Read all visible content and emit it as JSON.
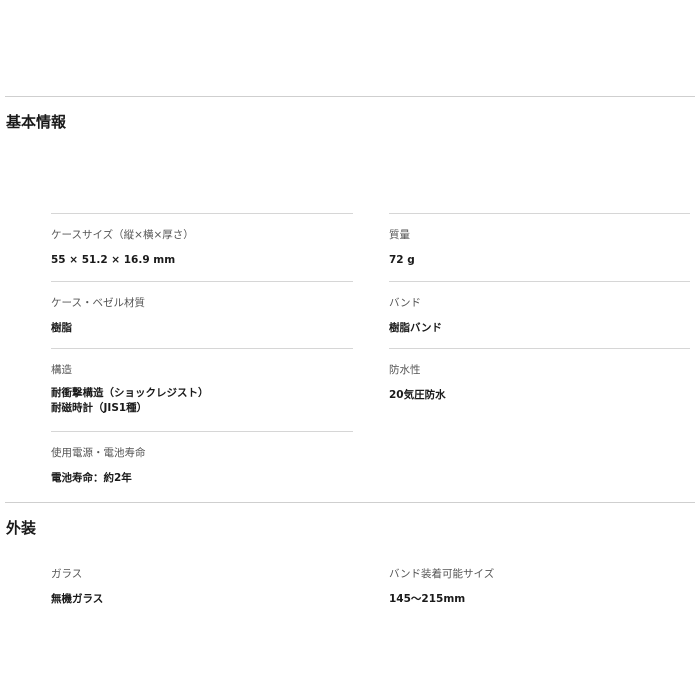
{
  "sections": [
    {
      "title": "基本情報",
      "specs": [
        {
          "label": "ケースサイズ（縦×横×厚さ）",
          "value": "55 × 51.2 × 16.9 mm"
        },
        {
          "label": "質量",
          "value": "72 g"
        },
        {
          "label": "ケース・ベゼル材質",
          "value": "樹脂"
        },
        {
          "label": "バンド",
          "value": "樹脂バンド"
        },
        {
          "label": "構造",
          "value_lines": [
            "耐衝撃構造（ショックレジスト）",
            "耐磁時計（JIS1種）"
          ]
        },
        {
          "label": "防水性",
          "value": "20気圧防水"
        },
        {
          "label": "使用電源・電池寿命",
          "value": "電池寿命：約2年"
        }
      ]
    },
    {
      "title": "外装",
      "specs": [
        {
          "label": "ガラス",
          "value": "無機ガラス"
        },
        {
          "label": "バンド装着可能サイズ",
          "value": "145〜215mm"
        }
      ]
    }
  ]
}
